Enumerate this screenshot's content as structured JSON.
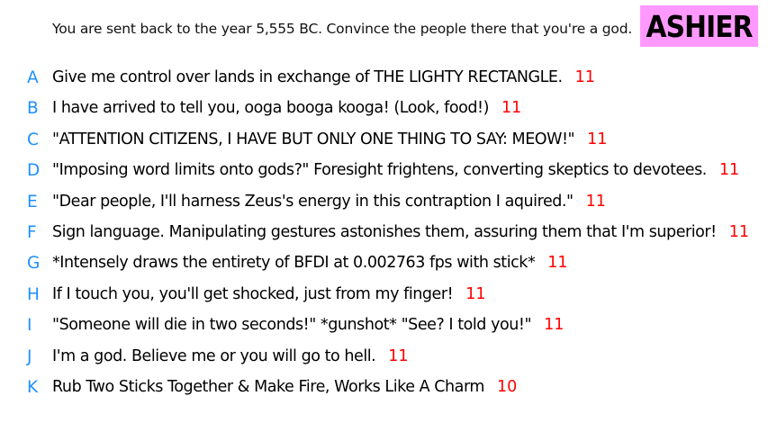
{
  "prompt": "You are sent back to the year 5,555 BC. Convince the people there that you're a god.",
  "player": "ASHIER",
  "colors": {
    "badge_background": "#ff99ff",
    "letter": "#1e90ff",
    "score": "#ff0000"
  },
  "entries": [
    {
      "letter": "A",
      "text": "Give me control over lands in exchange of THE LIGHTY RECTANGLE.",
      "score": "11"
    },
    {
      "letter": "B",
      "text": "I have arrived to tell you, ooga booga kooga! (Look, food!)",
      "score": "11"
    },
    {
      "letter": "C",
      "text": "\"ATTENTION CITIZENS, I HAVE BUT ONLY ONE THING TO SAY: MEOW!\"",
      "score": "11"
    },
    {
      "letter": "D",
      "text": "\"Imposing word limits onto gods?\" Foresight frightens, converting skeptics to devotees.",
      "score": "11"
    },
    {
      "letter": "E",
      "text": "\"Dear people, I'll harness Zeus's energy in this contraption I aquired.\"",
      "score": "11"
    },
    {
      "letter": "F",
      "text": "Sign language. Manipulating gestures astonishes them, assuring them that I'm superior!",
      "score": "11"
    },
    {
      "letter": "G",
      "text": "*Intensely draws the entirety of BFDI at 0.002763 fps with stick*",
      "score": "11"
    },
    {
      "letter": "H",
      "text": "If I touch you, you'll get shocked, just from my finger!",
      "score": "11"
    },
    {
      "letter": "I",
      "text": "\"Someone will die in two seconds!\" *gunshot* \"See? I told you!\"",
      "score": "11"
    },
    {
      "letter": "J",
      "text": "I'm a god. Believe me or you will go to hell.",
      "score": "11"
    },
    {
      "letter": "K",
      "text": "Rub Two Sticks Together & Make Fire, Works Like A Charm",
      "score": "10"
    }
  ]
}
